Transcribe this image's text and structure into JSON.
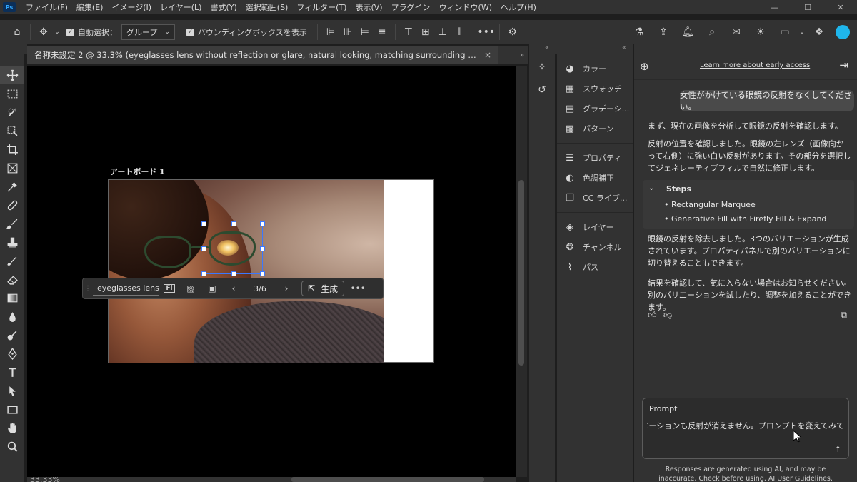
{
  "app": {
    "logo": "Ps"
  },
  "menu": [
    "ファイル(F)",
    "編集(E)",
    "イメージ(I)",
    "レイヤー(L)",
    "書式(Y)",
    "選択範囲(S)",
    "フィルター(T)",
    "表示(V)",
    "プラグイン",
    "ウィンドウ(W)",
    "ヘルプ(H)"
  ],
  "options": {
    "auto_select_label": "自動選択：",
    "auto_select_value": "グループ",
    "bounding_box_label": "バウンディングボックスを表示",
    "more": "•••"
  },
  "document": {
    "tab_title": "名称未設定 2 @ 33.3% (eyeglasses lens without reflection or glare, natural looking, matching surrounding skin and e...",
    "tab_close": "×",
    "artboard_label": "アートボード 1",
    "zoom": "33.33%"
  },
  "taskbar": {
    "prompt_value": "eyeglasses lens w",
    "counter": "3/6",
    "prev": "‹",
    "next": "›",
    "generate_label": "生成",
    "more": "•••"
  },
  "panels": {
    "group1": [
      {
        "label": "カラー",
        "icon": "color-palette-icon"
      },
      {
        "label": "スウォッチ",
        "icon": "swatches-icon"
      },
      {
        "label": "グラデーシ...",
        "icon": "gradient-icon"
      },
      {
        "label": "パターン",
        "icon": "pattern-icon"
      }
    ],
    "group2": [
      {
        "label": "プロパティ",
        "icon": "properties-icon"
      },
      {
        "label": "色調補正",
        "icon": "adjustments-icon"
      },
      {
        "label": "CC ライブ...",
        "icon": "libraries-icon"
      }
    ],
    "group3": [
      {
        "label": "レイヤー",
        "icon": "layers-icon"
      },
      {
        "label": "チャンネル",
        "icon": "channels-icon"
      },
      {
        "label": "パス",
        "icon": "paths-icon"
      }
    ]
  },
  "assistant": {
    "early_access_link": "Learn more about early access",
    "user_message": "女性がかけている眼鏡の反射をなくしてください。",
    "ai_intro": "まず、現在の画像を分析して眼鏡の反射を確認します。",
    "ai_analysis": "反射の位置を確認しました。眼鏡の左レンズ（画像向かって右側）に強い白い反射があります。その部分を選択してジェネレーティブフィルで自然に修正します。",
    "steps_title": "Steps",
    "steps": [
      "• Rectangular Marquee",
      "• Generative Fill with Firefly Fill & Expand"
    ],
    "ai_result": "眼鏡の反射を除去しました。3つのバリエーションが生成されています。プロパティパネルで別のバリエーションに切り替えることもできます。",
    "ai_followup": "結果を確認して、気に入らない場合はお知らせください。別のバリエーションを試したり、調整を加えることができます。",
    "prompt_label": "Prompt",
    "prompt_text": "どのバリエーションも反射が消えません。プロンプトを変えてみて",
    "disclaimer": "Responses are generated using AI, and may be inaccurate. Check before using. AI User Guidelines."
  }
}
